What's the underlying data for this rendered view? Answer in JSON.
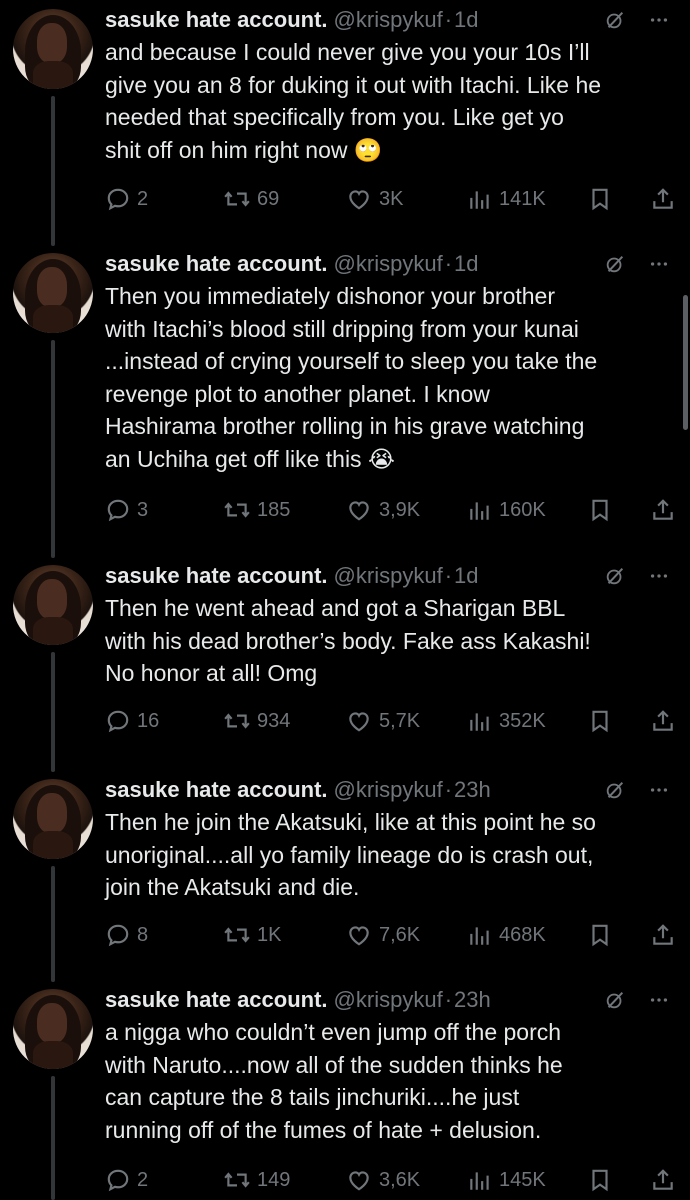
{
  "tweets": [
    {
      "name": "sasuke hate account.",
      "handle": "@krispykuf",
      "dot": "·",
      "time": "1d",
      "text": "and because I could never give you your 10s I’ll\ngive you an 8 for duking it out with Itachi. Like he\nneeded that specifically from you. Like get yo\nshit off on him right now 🙄",
      "replies": "2",
      "reposts": "69",
      "likes": "3K",
      "views": "141K"
    },
    {
      "name": "sasuke hate account.",
      "handle": "@krispykuf",
      "dot": "·",
      "time": "1d",
      "text": "Then you immediately dishonor your brother\nwith Itachi’s blood still dripping from your kunai\n...instead of crying yourself to sleep you take the\nrevenge plot to another planet. I know\nHashirama brother rolling in his grave watching\nan Uchiha get off like this 😭",
      "replies": "3",
      "reposts": "185",
      "likes": "3,9K",
      "views": "160K"
    },
    {
      "name": "sasuke hate account.",
      "handle": "@krispykuf",
      "dot": "·",
      "time": "1d",
      "text": "Then he went ahead and got a Sharigan BBL\nwith his dead brother’s body. Fake ass Kakashi!\nNo honor at all! Omg",
      "replies": "16",
      "reposts": "934",
      "likes": "5,7K",
      "views": "352K"
    },
    {
      "name": "sasuke hate account.",
      "handle": "@krispykuf",
      "dot": "·",
      "time": "23h",
      "text": "Then he join the Akatsuki, like at this point he so\nunoriginal....all yo family lineage do is crash out,\njoin the Akatsuki and die.",
      "replies": "8",
      "reposts": "1K",
      "likes": "7,6K",
      "views": "468K"
    },
    {
      "name": "sasuke hate account.",
      "handle": "@krispykuf",
      "dot": "·",
      "time": "23h",
      "text": "a nigga who couldn’t even jump off the porch\nwith Naruto....now all of the sudden thinks he\ncan capture the 8 tails jinchuriki....he just\nrunning off of the fumes of hate + delusion.",
      "replies": "2",
      "reposts": "149",
      "likes": "3,6K",
      "views": "145K"
    }
  ],
  "icons": {
    "reply": "reply-icon",
    "repost": "repost-icon",
    "like": "heart-icon",
    "views": "views-icon",
    "bookmark": "bookmark-icon",
    "share": "share-icon",
    "grok": "grok-icon",
    "more": "more-icon"
  },
  "colors": {
    "background": "#000000",
    "text": "#e7e9ea",
    "muted": "#71767b",
    "thread_line": "#333639"
  }
}
